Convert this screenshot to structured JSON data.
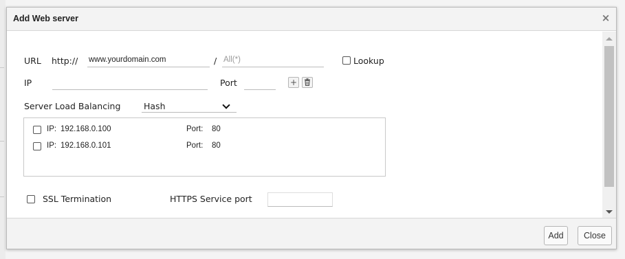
{
  "dialog": {
    "title": "Add Web server",
    "close_glyph": "×"
  },
  "url": {
    "label": "URL",
    "scheme": "http://",
    "domain_value": "www.yourdomain.com",
    "separator": "/",
    "path_placeholder": "All(*)",
    "lookup_label": "Lookup",
    "lookup_checked": false
  },
  "ip": {
    "label": "IP",
    "value": "",
    "port_label": "Port",
    "port_value": "",
    "add_icon": "plus-icon",
    "add_glyph": "+",
    "delete_icon": "trash-icon"
  },
  "load_balancing": {
    "label": "Server Load Balancing",
    "selected": "Hash"
  },
  "servers": [
    {
      "ip_label": "IP:",
      "ip": "192.168.0.100",
      "port_label": "Port:",
      "port": "80",
      "checked": false
    },
    {
      "ip_label": "IP:",
      "ip": "192.168.0.101",
      "port_label": "Port:",
      "port": "80",
      "checked": false
    }
  ],
  "ssl": {
    "label": "SSL Termination",
    "checked": false,
    "https_port_label": "HTTPS Service port",
    "https_port_value": ""
  },
  "footer": {
    "add_label": "Add",
    "close_label": "Close"
  }
}
